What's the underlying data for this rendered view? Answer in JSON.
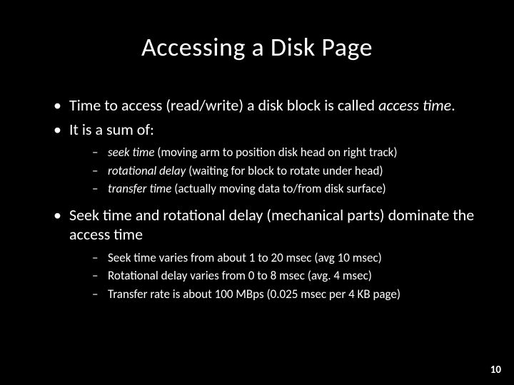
{
  "title": "Accessing a Disk Page",
  "bullets": {
    "b1_pre": "Time to access (read/write) a disk block is called ",
    "b1_em": "access time",
    "b1_post": ".",
    "b2": "It is a sum of:",
    "sub1": {
      "a_em": "seek time",
      "a_rest": " (moving arm to position disk head on right track)",
      "b_em": "rotational delay",
      "b_rest": " (waiting for block to rotate under head)",
      "c_em": "transfer time",
      "c_rest": " (actually moving data to/from disk surface)"
    },
    "b3": "Seek time and rotational delay (mechanical parts) dominate the access time",
    "sub2": {
      "a": "Seek time varies from about 1 to 20 msec  (avg 10 msec)",
      "b": "Rotational delay varies from 0 to 8 msec (avg. 4 msec)",
      "c": "Transfer rate is about 100 MBps (0.025 msec per 4 KB page)"
    }
  },
  "page_number": "10"
}
